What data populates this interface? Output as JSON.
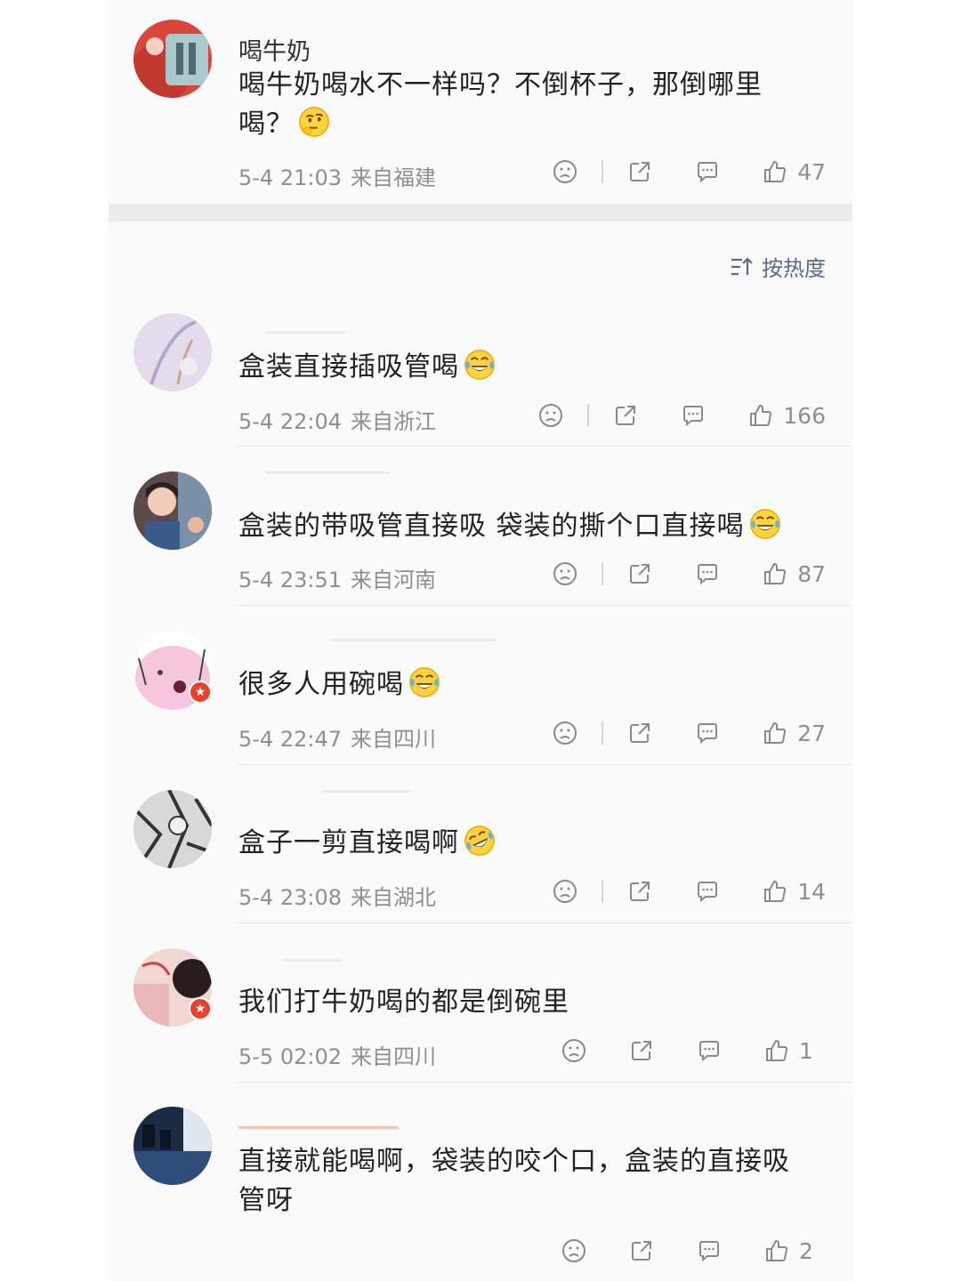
{
  "top_comment": {
    "username": "喝牛奶",
    "text": "喝牛奶喝水不一样吗？不倒杯子，那倒哪里喝？",
    "emoji": "thinking-face",
    "time": "5-4 21:03",
    "location": "来自福建",
    "likes": "47"
  },
  "sort": {
    "label": "按热度",
    "icon": "sort-icon"
  },
  "comments": [
    {
      "text": "盒装直接插吸管喝",
      "emoji": "tears-of-joy",
      "time": "5-4 22:04",
      "location": "来自浙江",
      "likes": "166"
    },
    {
      "text": "盒装的带吸管直接吸 袋装的撕个口直接喝",
      "emoji": "tears-of-joy",
      "time": "5-4 23:51",
      "location": "来自河南",
      "likes": "87"
    },
    {
      "text": "很多人用碗喝",
      "emoji": "tears-of-joy",
      "time": "5-4 22:47",
      "location": "来自四川",
      "likes": "27"
    },
    {
      "text": "盒子一剪直接喝啊",
      "emoji": "rolling-laughing",
      "time": "5-4 23:08",
      "location": "来自湖北",
      "likes": "14"
    },
    {
      "text": "我们打牛奶喝的都是倒碗里",
      "emoji": "",
      "time": "5-5 02:02",
      "location": "来自四川",
      "likes": "1"
    },
    {
      "text": "直接就能喝啊，袋装的咬个口，盒装的直接吸管呀",
      "emoji": "",
      "time": "",
      "location": "",
      "likes": "2"
    }
  ],
  "colors": {
    "accent": "#5a6b8c",
    "badge": "#e8412c",
    "muted": "#8f8f8f"
  }
}
